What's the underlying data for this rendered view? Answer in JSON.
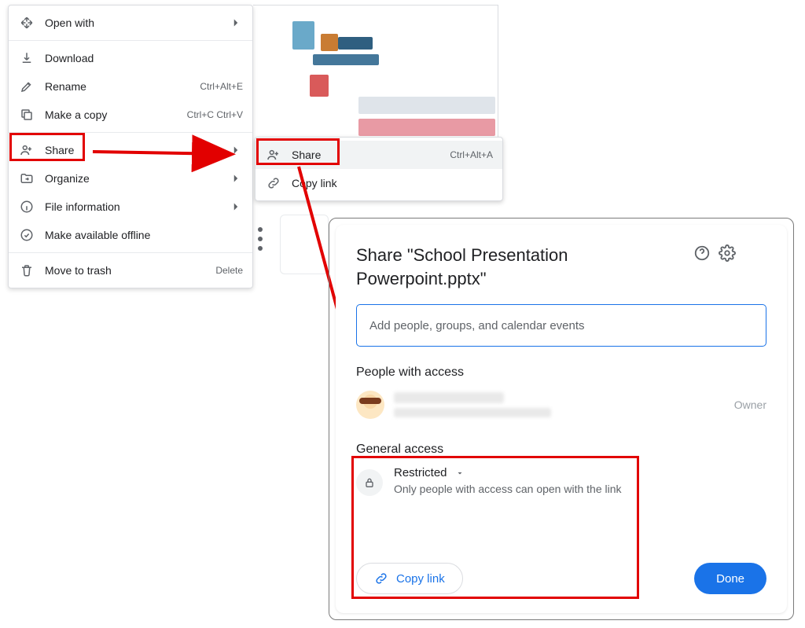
{
  "ctx": {
    "open_with": "Open with",
    "download": "Download",
    "rename": "Rename",
    "rename_sc": "Ctrl+Alt+E",
    "make_copy": "Make a copy",
    "make_copy_sc": "Ctrl+C Ctrl+V",
    "share": "Share",
    "organize": "Organize",
    "file_info": "File information",
    "offline": "Make available offline",
    "trash": "Move to trash",
    "trash_sc": "Delete"
  },
  "submenu": {
    "share": "Share",
    "share_sc": "Ctrl+Alt+A",
    "copy_link": "Copy link"
  },
  "dialog": {
    "title": "Share \"School Presentation Powerpoint.pptx\"",
    "add_placeholder": "Add people, groups, and calendar events",
    "people_h": "People with access",
    "owner": "Owner",
    "ga_h": "General access",
    "restricted": "Restricted",
    "ga_sub": "Only people with access can open with the link",
    "copy_link": "Copy link",
    "done": "Done"
  }
}
